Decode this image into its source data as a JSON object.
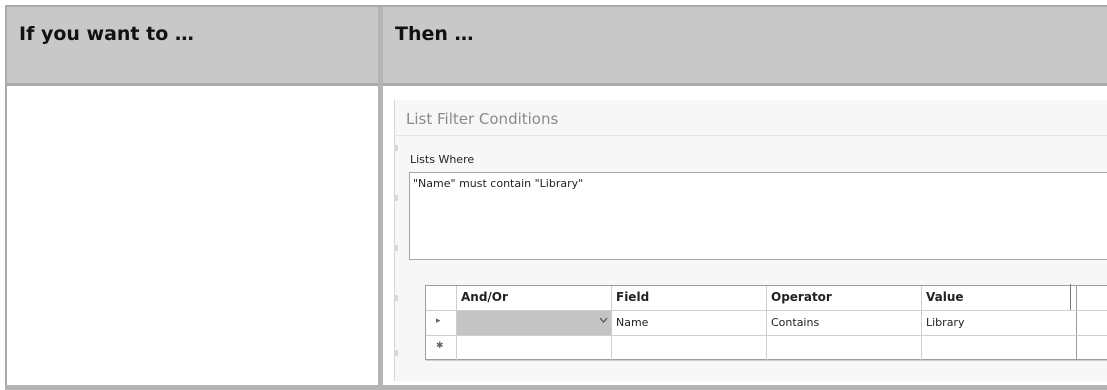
{
  "table": {
    "header_left": "If you want to …",
    "header_right": "Then …"
  },
  "dialog": {
    "title": "List Filter Conditions",
    "lists_where_label": "Lists Where",
    "condition_text": "\"Name\" must contain \"Library\"",
    "grid": {
      "columns": [
        "And/Or",
        "Field",
        "Operator",
        "Value"
      ],
      "rows": [
        {
          "marker": "▸",
          "and_or": "",
          "field": "Name",
          "operator": "Contains",
          "value": "Library"
        },
        {
          "marker": "✱",
          "and_or": "",
          "field": "",
          "operator": "",
          "value": ""
        }
      ]
    }
  }
}
